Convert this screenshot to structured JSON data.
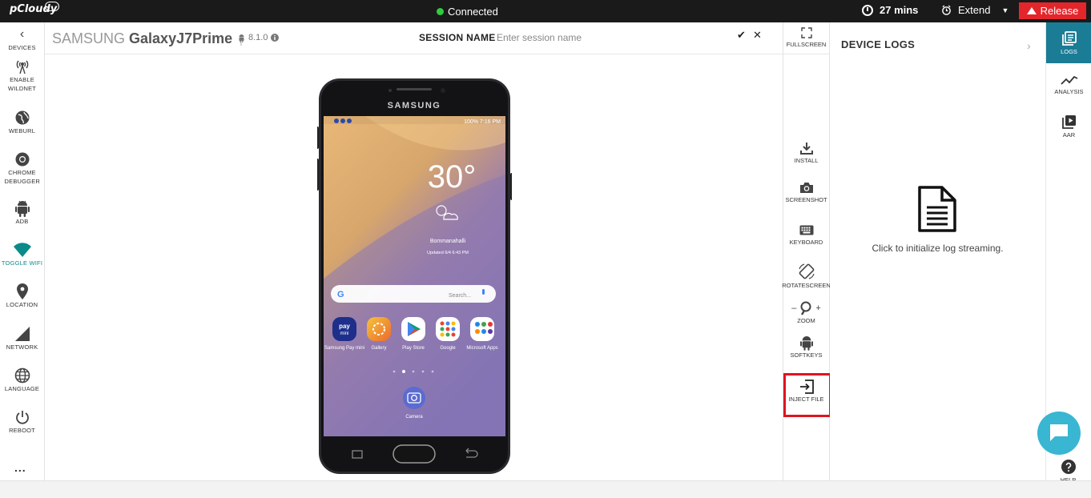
{
  "topbar": {
    "logo": "pCloudy",
    "status": "Connected",
    "status_color": "#2ecc40",
    "timer": "27 mins",
    "extend_label": "Extend",
    "release_label": "Release",
    "release_color": "#e3262b"
  },
  "left_sidebar": {
    "items": [
      {
        "label": "DEVICES",
        "icon": "chevron-left-icon"
      },
      {
        "label": "ENABLE WILDNET",
        "icon": "wildnet-icon"
      },
      {
        "label": "WEBURL",
        "icon": "globe-icon"
      },
      {
        "label": "CHROME DEBUGGER",
        "icon": "chrome-icon"
      },
      {
        "label": "ADB",
        "icon": "android-icon"
      },
      {
        "label": "TOGGLE WIFI",
        "icon": "wifi-icon",
        "active": true
      },
      {
        "label": "LOCATION",
        "icon": "location-pin-icon"
      },
      {
        "label": "NETWORK",
        "icon": "network-icon"
      },
      {
        "label": "LANGUAGE",
        "icon": "language-globe-icon"
      },
      {
        "label": "REBOOT",
        "icon": "power-icon"
      }
    ],
    "more": "..."
  },
  "header": {
    "brand": "SAMSUNG",
    "model": "GalaxyJ7Prime",
    "android_version": "8.1.0",
    "session_label": "SESSION NAME",
    "session_placeholder": "Enter session name"
  },
  "phone": {
    "brand": "SAMSUNG",
    "status_bar": "100% 7:16 PM",
    "temperature": "30°",
    "location": "Bommanahalli",
    "updated": "Updated 6/4 6:43 PM",
    "search_placeholder": "Search...",
    "apps": [
      {
        "label": "Samsung Pay mini",
        "color": "#1d2f8a"
      },
      {
        "label": "Gallery",
        "color": "#f0a02b"
      },
      {
        "label": "Play Store",
        "color": "#ffffff"
      },
      {
        "label": "Google",
        "color": "#ffffff"
      },
      {
        "label": "Microsoft Apps",
        "color": "#ffffff"
      }
    ],
    "dock_app": "Camera"
  },
  "toolbar": {
    "fullscreen": "FULLSCREEN",
    "items": [
      {
        "label": "INSTALL",
        "icon": "download-icon"
      },
      {
        "label": "SCREENSHOT",
        "icon": "camera-icon"
      },
      {
        "label": "KEYBOARD",
        "icon": "keyboard-icon"
      },
      {
        "label": "ROTATESCREEN",
        "icon": "rotate-icon"
      },
      {
        "label": "ZOOM",
        "icon": "zoom-icon"
      },
      {
        "label": "SOFTKEYS",
        "icon": "android-icon"
      },
      {
        "label": "INJECT FILE",
        "icon": "inject-file-icon",
        "highlighted": true
      }
    ],
    "zoom_minus": "–",
    "zoom_plus": "+"
  },
  "logs_panel": {
    "title": "DEVICE LOGS",
    "message": "Click to initialize log streaming."
  },
  "right_rail": {
    "items": [
      {
        "label": "LOGS",
        "icon": "logs-icon",
        "active": true
      },
      {
        "label": "ANALYSIS",
        "icon": "analysis-icon"
      },
      {
        "label": "AAR",
        "icon": "play-icon"
      }
    ],
    "help": "HELP",
    "accent": "#1b7c96"
  }
}
